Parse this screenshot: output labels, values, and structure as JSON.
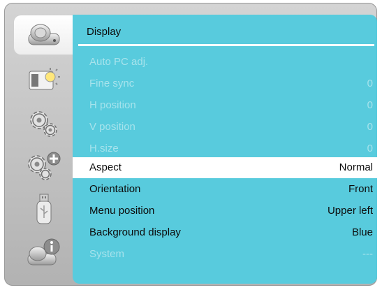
{
  "panel": {
    "title": "Display",
    "items": [
      {
        "label": "Auto PC adj.",
        "value": ""
      },
      {
        "label": "Fine sync",
        "value": "0"
      },
      {
        "label": "H position",
        "value": "0"
      },
      {
        "label": "V position",
        "value": "0"
      },
      {
        "label": "H.size",
        "value": "0"
      },
      {
        "label": "Aspect",
        "value": "Normal"
      },
      {
        "label": "Orientation",
        "value": "Front"
      },
      {
        "label": "Menu position",
        "value": "Upper left"
      },
      {
        "label": "Background display",
        "value": "Blue"
      },
      {
        "label": "System",
        "value": "---"
      }
    ]
  },
  "sidebar": {
    "icons": [
      "projector-icon",
      "picture-adjust-icon",
      "setting-gears-icon",
      "expanded-setting-icon",
      "usb-icon",
      "information-icon"
    ]
  },
  "colors": {
    "panel": "#58cbdd",
    "disabled_text": "#a7e3ec",
    "selected_row": "#ffffff",
    "frame": "#c4c4c4"
  }
}
